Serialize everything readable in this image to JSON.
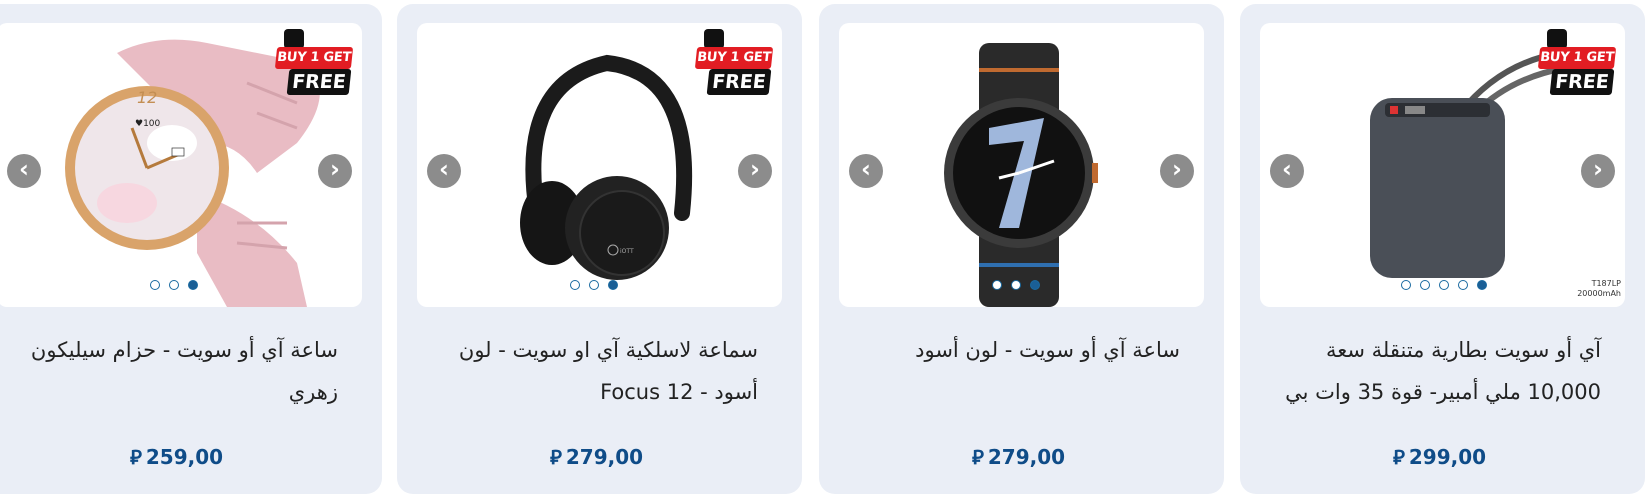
{
  "products": [
    {
      "title": "ساعة آي أو سويت - حزام سيليكون زهري",
      "price": "259,00",
      "currency_symbol": "⃁",
      "promo_top": "BUY 1 GET 1",
      "promo_bottom": "FREE",
      "dots": 3,
      "active_dot": 3,
      "image_icon": "pink-smartwatch"
    },
    {
      "title": "سماعة لاسلكية آي او سويت - لون أسود - Focus 12",
      "price": "279,00",
      "currency_symbol": "⃁",
      "promo_top": "BUY 1 GET 1",
      "promo_bottom": "FREE",
      "dots": 3,
      "active_dot": 3,
      "image_icon": "black-headphones"
    },
    {
      "title": "ساعة آي أو سويت - لون أسود",
      "price": "279,00",
      "currency_symbol": "⃁",
      "dots": 3,
      "active_dot": 3,
      "image_icon": "black-smartwatch"
    },
    {
      "title": "آي أو سويت بطارية متنقلة سعة 10,000 ملي أمبير- قوة 35 وات بي",
      "price": "299,00",
      "currency_symbol": "⃁",
      "promo_top": "BUY 1 GET 1",
      "promo_bottom": "FREE",
      "dots": 5,
      "active_dot": 5,
      "sku_line1": "T187LP",
      "sku_line2": "20000mAh",
      "image_icon": "power-bank"
    }
  ],
  "arrows": {
    "prev": "‹",
    "next": "›"
  },
  "colors": {
    "price": "#0f4c88",
    "card_bg": "#eaeef6",
    "promo_red": "#e21d23"
  }
}
